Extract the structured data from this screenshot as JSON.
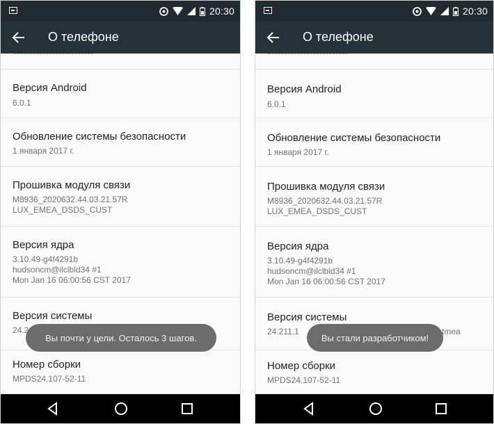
{
  "status_bar": {
    "time": "20:30",
    "icons": [
      "notification-icon",
      "alarm-icon",
      "wifi-icon",
      "signal-icon",
      "battery-icon"
    ]
  },
  "phones": [
    {
      "title": "О телефоне",
      "items": [
        {
          "title": "Версия Android",
          "lines": [
            "6.0.1"
          ]
        },
        {
          "title": "Обновление системы безопасности",
          "lines": [
            "1 января 2017 г."
          ]
        },
        {
          "title": "Прошивка модуля связи",
          "lines": [
            "M8936_2020632.44.03.21.57R",
            "LUX_EMEA_DSDS_CUST"
          ]
        },
        {
          "title": "Версия ядра",
          "lines": [
            "3.10.49-g4f4291b",
            "hudsoncm@ilclbld34 #1",
            "Mon Jan 16 06:00:56 CST 2017"
          ]
        },
        {
          "title": "Версия системы",
          "lines": [
            "24.2"
          ]
        },
        {
          "title": "Номер сборки",
          "lines": [
            "MPDS24.107-52-11"
          ]
        }
      ],
      "toast": "Вы почти у цели. Осталось 3 шагов."
    },
    {
      "title": "О телефоне",
      "items": [
        {
          "title": "Версия Android",
          "lines": [
            "6.0.1"
          ]
        },
        {
          "title": "Обновление системы безопасности",
          "lines": [
            "1 января 2017 г."
          ]
        },
        {
          "title": "Прошивка модуля связи",
          "lines": [
            "M8936_2020632.44.03.21.57R",
            "LUX_EMEA_DSDS_CUST"
          ]
        },
        {
          "title": "Версия ядра",
          "lines": [
            "3.10.49-g4f4291b",
            "hudsoncm@ilclbld34 #1",
            "Mon Jan 16 06:00:56 CST 2017"
          ]
        },
        {
          "title": "Версия системы",
          "lines": [
            "24.211.1",
            "tmea"
          ]
        },
        {
          "title": "Номер сборки",
          "lines": [
            "MPDS24.107-52-11"
          ]
        }
      ],
      "toast": "Вы стали разработчиком!"
    }
  ],
  "nav_bar": {
    "icons": [
      "back-triangle-icon",
      "home-circle-icon",
      "recents-square-icon"
    ]
  }
}
